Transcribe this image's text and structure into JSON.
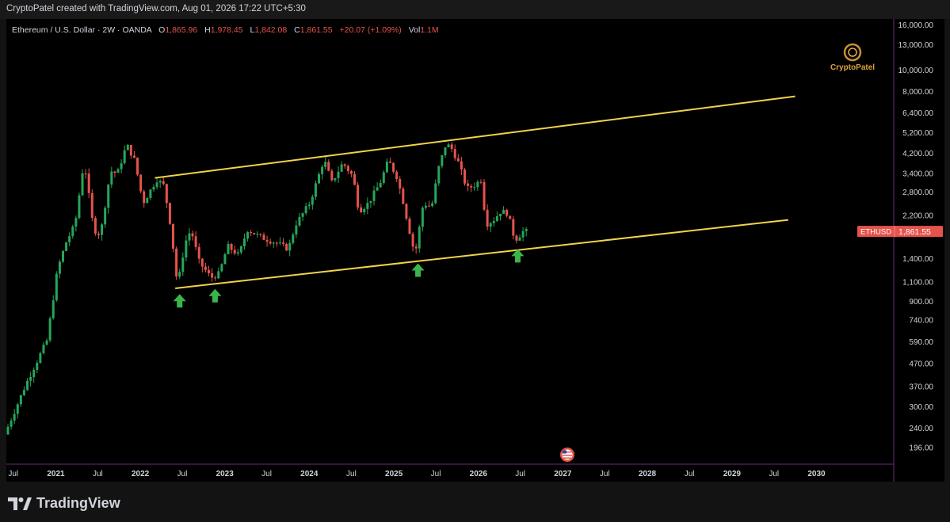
{
  "header": {
    "created_by": "CryptoPatel created with TradingView.com, Aug 01, 2026 17:22 UTC+5:30"
  },
  "legend": {
    "symbol": "Ethereum / U.S. Dollar · 2W · OANDA",
    "o_label": "O",
    "o_value": "1,865.96",
    "h_label": "H",
    "h_value": "1,978.45",
    "l_label": "L",
    "l_value": "1,842.08",
    "c_label": "C",
    "c_value": "1,861.55",
    "change": "+20.07 (+1.09%)",
    "vol_label": "Vol",
    "vol_value": "1.1M"
  },
  "watermark": {
    "text": "CryptoPatel"
  },
  "price_tag": {
    "symbol": "ETHUSD",
    "value": "1,861.55"
  },
  "brand": {
    "name": "TradingView"
  },
  "colors": {
    "up": "#26a65b",
    "down": "#e5534b",
    "trendline": "#f2d24b",
    "arrow": "#3bb54a",
    "axis_text": "#d1d4dc",
    "tag_bg": "#e5534b",
    "purple_line": "#9b4fb0"
  },
  "chart_data": {
    "type": "candlestick",
    "scale": "log",
    "ylim": [
      165,
      17000
    ],
    "y_ticks": [
      "16,000.00",
      "13,000.00",
      "10,000.00",
      "8,000.00",
      "6,400.00",
      "5,200.00",
      "4,200.00",
      "3,400.00",
      "2,800.00",
      "2,200.00",
      "1,400.00",
      "1,100.00",
      "900.00",
      "740.00",
      "590.00",
      "470.00",
      "370.00",
      "300.00",
      "240.00",
      "196.00"
    ],
    "y_tick_values": [
      16000,
      13000,
      10000,
      8000,
      6400,
      5200,
      4200,
      3400,
      2800,
      2200,
      1400,
      1100,
      900,
      740,
      590,
      470,
      370,
      300,
      240,
      196
    ],
    "x_range": [
      "2020-06-01",
      "2030-12-01"
    ],
    "x_ticks": [
      {
        "d": "2020-07-01",
        "label": "Jul",
        "bold": false
      },
      {
        "d": "2021-01-01",
        "label": "2021",
        "bold": true
      },
      {
        "d": "2021-07-01",
        "label": "Jul",
        "bold": false
      },
      {
        "d": "2022-01-01",
        "label": "2022",
        "bold": true
      },
      {
        "d": "2022-07-01",
        "label": "Jul",
        "bold": false
      },
      {
        "d": "2023-01-01",
        "label": "2023",
        "bold": true
      },
      {
        "d": "2023-07-01",
        "label": "Jul",
        "bold": false
      },
      {
        "d": "2024-01-01",
        "label": "2024",
        "bold": true
      },
      {
        "d": "2024-07-01",
        "label": "Jul",
        "bold": false
      },
      {
        "d": "2025-01-01",
        "label": "2025",
        "bold": true
      },
      {
        "d": "2025-07-01",
        "label": "Jul",
        "bold": false
      },
      {
        "d": "2026-01-01",
        "label": "2026",
        "bold": true
      },
      {
        "d": "2026-07-01",
        "label": "Jul",
        "bold": false
      },
      {
        "d": "2027-01-01",
        "label": "2027",
        "bold": true
      },
      {
        "d": "2027-07-01",
        "label": "Jul",
        "bold": false
      },
      {
        "d": "2028-01-01",
        "label": "2028",
        "bold": true
      },
      {
        "d": "2028-07-01",
        "label": "Jul",
        "bold": false
      },
      {
        "d": "2029-01-01",
        "label": "2029",
        "bold": true
      },
      {
        "d": "2029-07-01",
        "label": "Jul",
        "bold": false
      },
      {
        "d": "2030-01-01",
        "label": "2030",
        "bold": true
      }
    ],
    "price_path": [
      [
        "2020-06-01",
        225
      ],
      [
        "2020-09-01",
        380
      ],
      [
        "2020-12-01",
        600
      ],
      [
        "2021-01-15",
        1250
      ],
      [
        "2021-02-20",
        1650
      ],
      [
        "2021-04-01",
        2000
      ],
      [
        "2021-05-10",
        3900
      ],
      [
        "2021-06-20",
        1900
      ],
      [
        "2021-07-20",
        1800
      ],
      [
        "2021-09-01",
        3500
      ],
      [
        "2021-10-01",
        3400
      ],
      [
        "2021-11-10",
        4600
      ],
      [
        "2021-12-15",
        3900
      ],
      [
        "2022-01-20",
        2500
      ],
      [
        "2022-03-20",
        3200
      ],
      [
        "2022-04-20",
        3000
      ],
      [
        "2022-05-20",
        1950
      ],
      [
        "2022-06-18",
        1050
      ],
      [
        "2022-07-20",
        1650
      ],
      [
        "2022-08-15",
        1900
      ],
      [
        "2022-09-20",
        1350
      ],
      [
        "2022-11-10",
        1150
      ],
      [
        "2022-12-15",
        1200
      ],
      [
        "2023-01-20",
        1600
      ],
      [
        "2023-03-10",
        1450
      ],
      [
        "2023-04-15",
        1900
      ],
      [
        "2023-06-15",
        1750
      ],
      [
        "2023-08-20",
        1650
      ],
      [
        "2023-10-10",
        1550
      ],
      [
        "2023-11-10",
        2000
      ],
      [
        "2024-01-10",
        2500
      ],
      [
        "2024-03-12",
        3950
      ],
      [
        "2024-04-15",
        3100
      ],
      [
        "2024-06-01",
        3800
      ],
      [
        "2024-07-15",
        3300
      ],
      [
        "2024-08-10",
        2300
      ],
      [
        "2024-09-20",
        2500
      ],
      [
        "2024-11-10",
        3100
      ],
      [
        "2024-12-15",
        3900
      ],
      [
        "2025-01-20",
        3300
      ],
      [
        "2025-02-15",
        2600
      ],
      [
        "2025-03-15",
        1900
      ],
      [
        "2025-04-09",
        1450
      ],
      [
        "2025-05-15",
        2500
      ],
      [
        "2025-06-20",
        2400
      ],
      [
        "2025-07-20",
        3600
      ],
      [
        "2025-08-20",
        4600
      ],
      [
        "2025-09-10",
        4500
      ],
      [
        "2025-10-10",
        3900
      ],
      [
        "2025-11-20",
        2900
      ],
      [
        "2025-12-20",
        3000
      ],
      [
        "2026-01-20",
        3200
      ],
      [
        "2026-02-10",
        2000
      ],
      [
        "2026-03-15",
        2100
      ],
      [
        "2026-04-15",
        2300
      ],
      [
        "2026-05-15",
        2250
      ],
      [
        "2026-06-15",
        1700
      ],
      [
        "2026-07-20",
        1860
      ]
    ],
    "trendlines": [
      {
        "name": "upper",
        "from": [
          "2022-03-05",
          3250
        ],
        "to": [
          "2029-10-01",
          7600
        ]
      },
      {
        "name": "lower",
        "from": [
          "2022-06-01",
          1030
        ],
        "to": [
          "2029-09-01",
          2100
        ]
      }
    ],
    "support_arrows": [
      {
        "d": "2022-06-20",
        "price": 900
      },
      {
        "d": "2022-11-20",
        "price": 950
      },
      {
        "d": "2025-04-15",
        "price": 1240
      },
      {
        "d": "2026-06-20",
        "price": 1440
      }
    ]
  }
}
